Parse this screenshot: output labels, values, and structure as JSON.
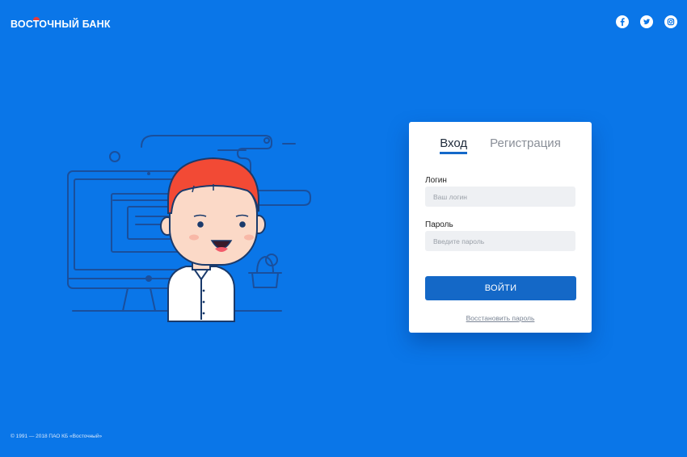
{
  "header": {
    "logo_text": "ВОСТОЧНЫЙ БАНК",
    "social": [
      {
        "name": "facebook-icon"
      },
      {
        "name": "twitter-icon"
      },
      {
        "name": "instagram-icon"
      }
    ]
  },
  "login": {
    "tabs": [
      {
        "label": "Вход",
        "active": true
      },
      {
        "label": "Регистрация",
        "active": false
      }
    ],
    "login_label": "Логин",
    "login_placeholder": "Ваш логин",
    "login_value": "",
    "password_label": "Пароль",
    "password_placeholder": "Введите пароль",
    "password_value": "",
    "submit_label": "ВОЙТИ",
    "restore_label": "Восстановить пароль"
  },
  "footer": {
    "copyright": "© 1991 — 2018 ПАО КБ «Восточный»"
  },
  "colors": {
    "background": "#0A76E8",
    "accent": "#1468C7",
    "logo_mark": "#E63B3B",
    "hair": "#F24A35"
  }
}
